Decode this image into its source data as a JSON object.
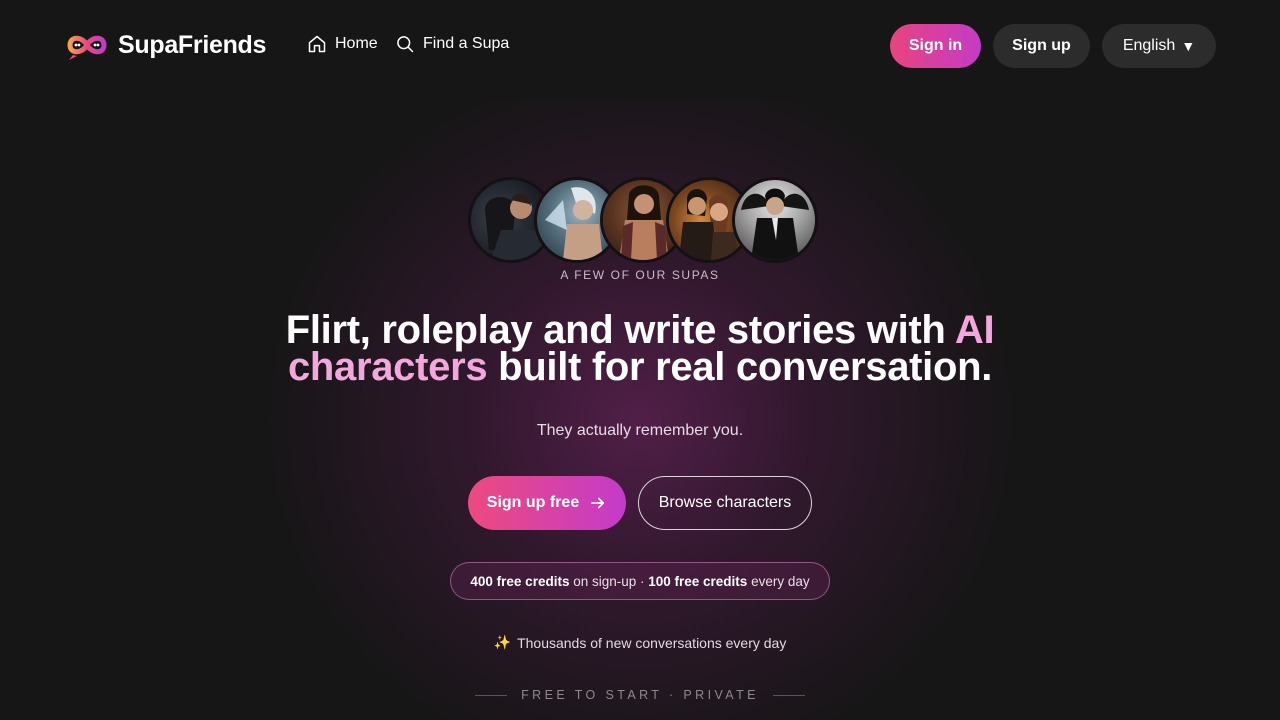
{
  "header": {
    "brand_name": "SupaFriends",
    "nav": [
      {
        "label": "Home",
        "icon": "home-icon"
      },
      {
        "label": "Find a Supa",
        "icon": "search-icon"
      }
    ],
    "signin_label": "Sign in",
    "signup_label": "Sign up",
    "language": {
      "selected": "English",
      "caret": "▼"
    }
  },
  "hero": {
    "avatars": [
      {
        "name": "avatar-1"
      },
      {
        "name": "avatar-2"
      },
      {
        "name": "avatar-3"
      },
      {
        "name": "avatar-4"
      },
      {
        "name": "avatar-5"
      }
    ],
    "avatars_caption": "A FEW OF OUR SUPAS",
    "headline_part1": "Flirt, roleplay and write stories with ",
    "headline_accent": "AI characters",
    "headline_part2": " built for real conversation.",
    "subline": "They actually remember you.",
    "cta_primary": "Sign up free",
    "cta_secondary": "Browse characters",
    "credits": {
      "signup_amount": "400 free credits",
      "signup_suffix": " on sign-up · ",
      "daily_amount": "100 free credits",
      "daily_suffix": " every day"
    },
    "activity_icon": "✨",
    "activity_text": "Thousands of new conversations every day",
    "footer_tag": "FREE TO START · PRIVATE"
  },
  "colors": {
    "background": "#161616",
    "accent_pink": "#e8447f",
    "accent_purple": "#c43bc6",
    "headline_accent": "#f3a7dc",
    "pill_dark": "#2c2c2c"
  }
}
